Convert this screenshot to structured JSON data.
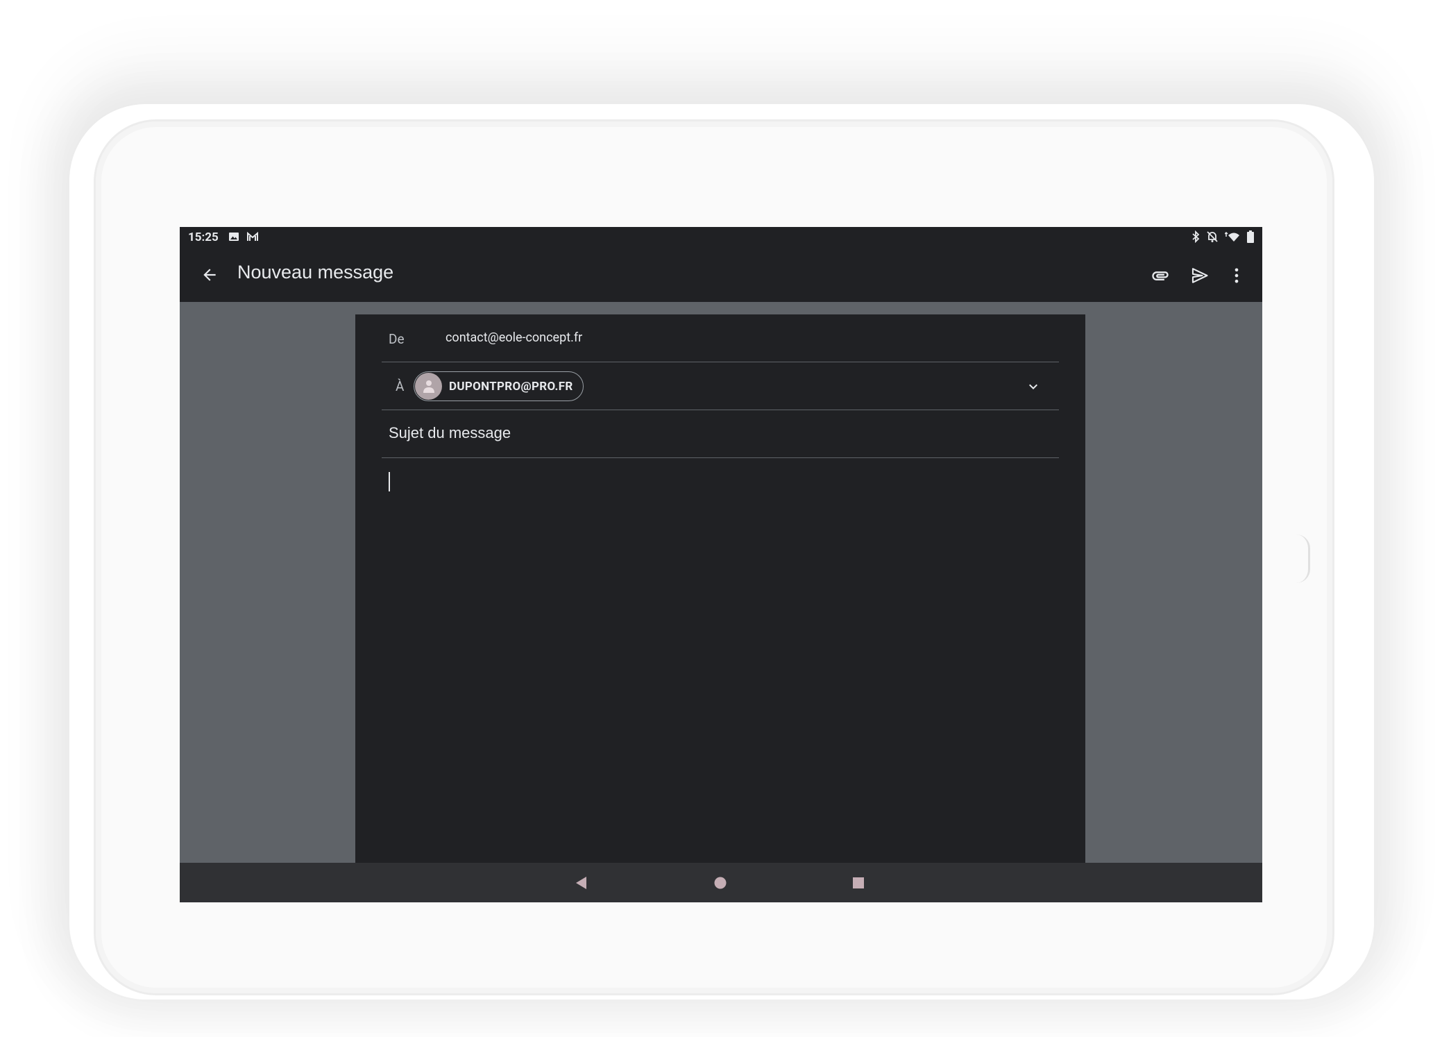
{
  "status_bar": {
    "time": "15:25",
    "left_icons": [
      "image-notification-icon",
      "gmail-notification-icon"
    ],
    "right_icons": [
      "bluetooth-icon",
      "notifications-off-icon",
      "wifi-icon",
      "battery-icon"
    ]
  },
  "app_bar": {
    "title": "Nouveau message",
    "actions": [
      "attach-icon",
      "send-icon",
      "more-vert-icon"
    ]
  },
  "compose": {
    "from_label": "De",
    "from_value": "contact@eole-concept.fr",
    "to_label": "À",
    "recipient_chip": "DUPONTPRO@PRO.FR",
    "subject_placeholder": "Sujet du message",
    "body": ""
  },
  "nav_bar": {
    "buttons": [
      "back-triangle-icon",
      "home-circle-icon",
      "recents-square-icon"
    ]
  },
  "colors": {
    "app_bar": "#202124",
    "screen_background": "#5f6368",
    "compose_background": "#202124",
    "nav_bar": "#303134",
    "text": "#e8eaed",
    "nav_icons": "#c5aeb5"
  }
}
